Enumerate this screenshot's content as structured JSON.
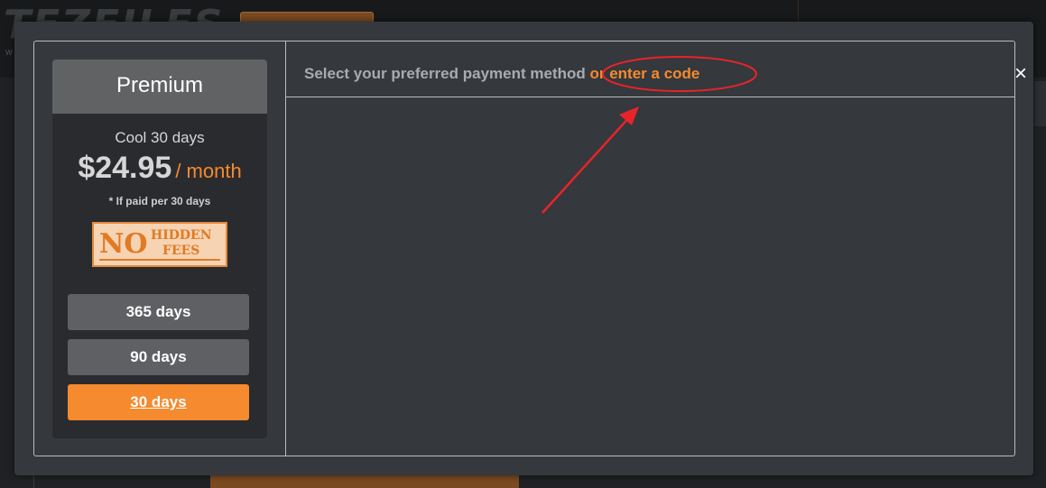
{
  "background": {
    "logo_text": "TEZFILES",
    "logo_sub": "W"
  },
  "modal": {
    "close_label": "×",
    "plan": {
      "title": "Premium",
      "subtitle": "Cool 30 days",
      "price": "$24.95",
      "period": "/ month",
      "note": "* If paid per 30 days",
      "badge": {
        "no": "NO",
        "hidden": "HIDDEN",
        "fees": "FEES"
      },
      "durations": [
        {
          "label": "365 days",
          "active": false
        },
        {
          "label": "90 days",
          "active": false
        },
        {
          "label": "30 days",
          "active": true
        }
      ]
    },
    "payment": {
      "prompt": "Select your preferred payment method",
      "code_link": "or enter a code"
    }
  },
  "colors": {
    "accent": "#f58a2e",
    "annotation": "#e8242a"
  }
}
